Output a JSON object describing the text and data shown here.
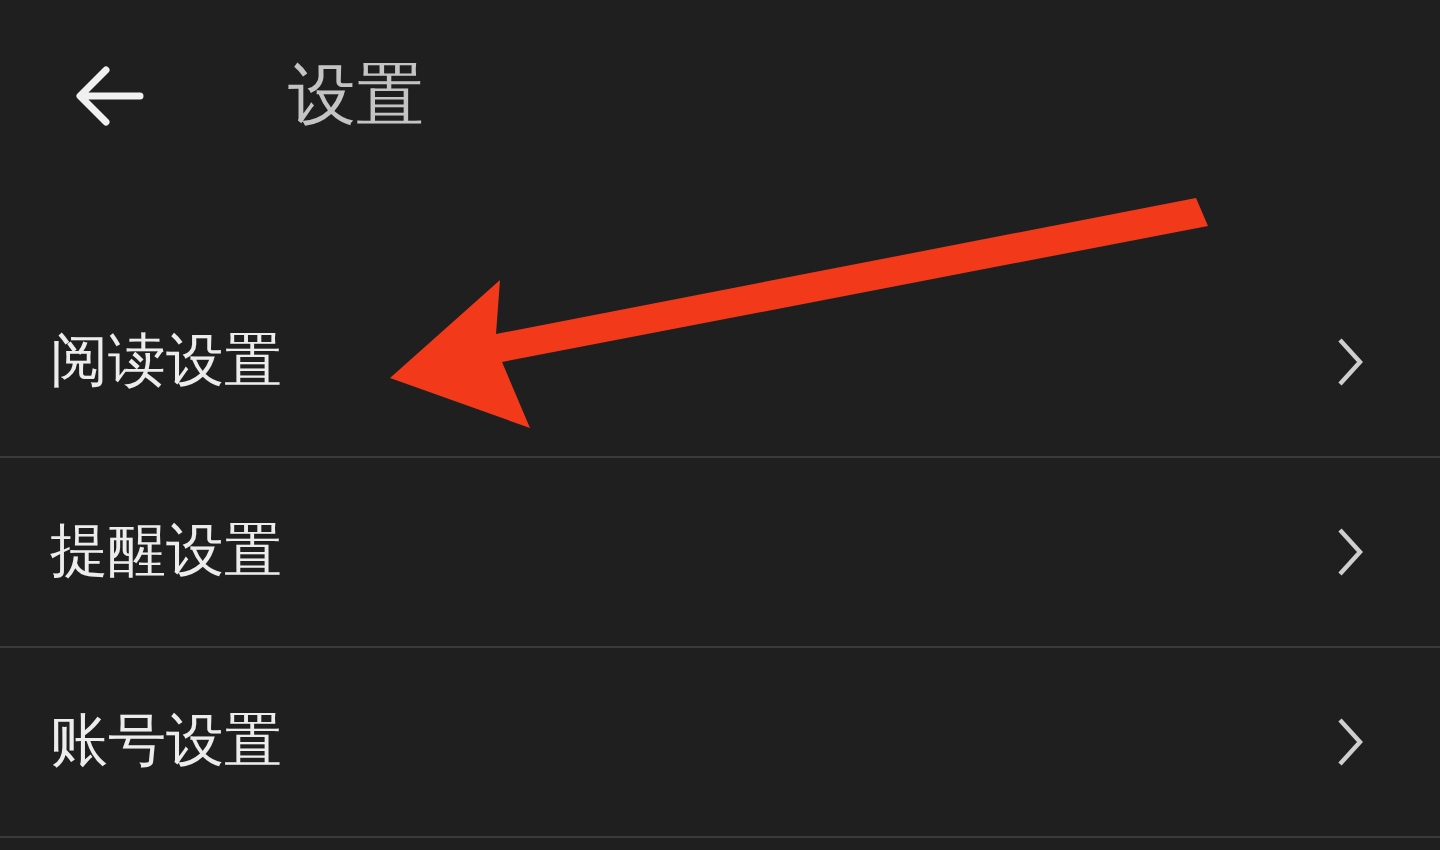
{
  "header": {
    "title": "设置"
  },
  "items": [
    {
      "label": "阅读设置"
    },
    {
      "label": "提醒设置"
    },
    {
      "label": "账号设置"
    }
  ]
}
